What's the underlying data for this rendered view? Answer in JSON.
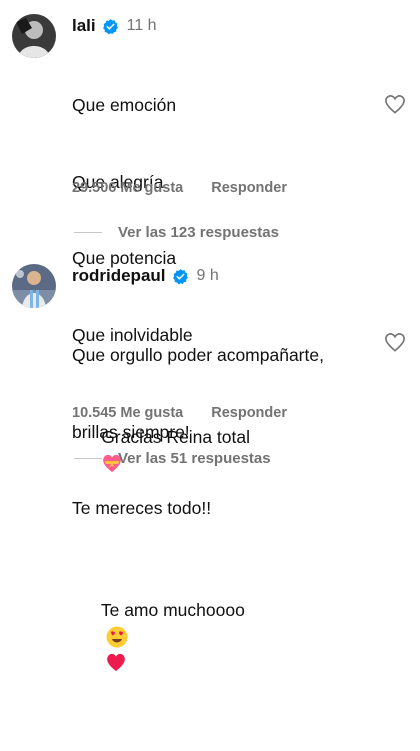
{
  "comments": [
    {
      "username": "lali",
      "time": "11 h",
      "lines": [
        "Que emoción",
        "Que alegría",
        "Que potencia",
        "Que inolvidable",
        "Gracias Reina total"
      ],
      "likes": "29.506 Me gusta",
      "reply_label": "Responder",
      "view_replies": "Ver las 123 respuestas",
      "trailing_emojis": [
        "heart-with-ribbon"
      ]
    },
    {
      "username": "rodridepaul",
      "time": "9 h",
      "lines": [
        "Que orgullo poder acompañarte,",
        "brillas siempre!",
        "Te mereces todo!!",
        "Te amo muchoooo"
      ],
      "likes": "10.545 Me gusta",
      "reply_label": "Responder",
      "view_replies": "Ver las 51 respuestas",
      "trailing_emojis": [
        "heart-eyes-face",
        "red-heart"
      ]
    }
  ],
  "colors": {
    "text": "#111111",
    "secondary": "#737373",
    "verified": "#0095f6",
    "divider": "#c7c7c7"
  }
}
